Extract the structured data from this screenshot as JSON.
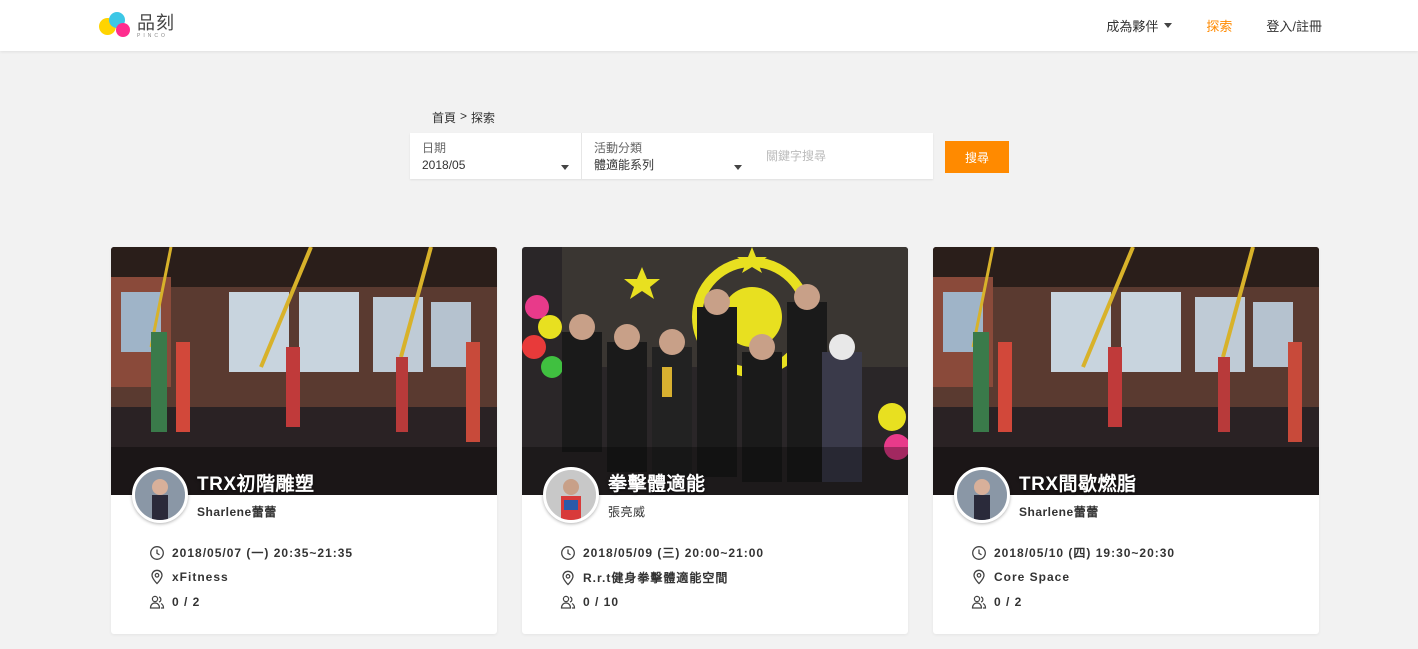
{
  "header": {
    "logo_text": "品刻",
    "logo_sub": "PINCO",
    "nav": [
      {
        "label": "成為夥伴",
        "has_dropdown": true,
        "active": false
      },
      {
        "label": "探索",
        "has_dropdown": false,
        "active": true
      },
      {
        "label": "登入/註冊",
        "has_dropdown": false,
        "active": false
      }
    ]
  },
  "breadcrumb": {
    "home": "首頁",
    "separator": ">",
    "current": "探索"
  },
  "search": {
    "date_label": "日期",
    "date_value": "2018/05",
    "category_label": "活動分類",
    "category_value": "體適能系列",
    "keyword_placeholder": "關鍵字搜尋",
    "button_label": "搜尋"
  },
  "cards": [
    {
      "title": "TRX初階雕塑",
      "host": "Sharlene蕾蕾",
      "datetime": "2018/05/07 (一) 20:35~21:35",
      "location": "xFitness",
      "participants": "0 / 2"
    },
    {
      "title": "拳擊體適能",
      "host": "張亮威",
      "datetime": "2018/05/09 (三) 20:00~21:00",
      "location": "R.r.t健身拳擊體適能空間",
      "participants": "0 / 10"
    },
    {
      "title": "TRX間歇燃脂",
      "host": "Sharlene蕾蕾",
      "datetime": "2018/05/10 (四) 19:30~20:30",
      "location": "Core Space",
      "participants": "0 / 2"
    }
  ],
  "colors": {
    "accent": "#ff8a00",
    "background": "#f2f2f2",
    "card": "#ffffff",
    "text": "#333333"
  },
  "icons": {
    "time": "clock-icon",
    "location": "map-pin-icon",
    "participants": "users-icon",
    "dropdown": "caret-down-icon"
  }
}
